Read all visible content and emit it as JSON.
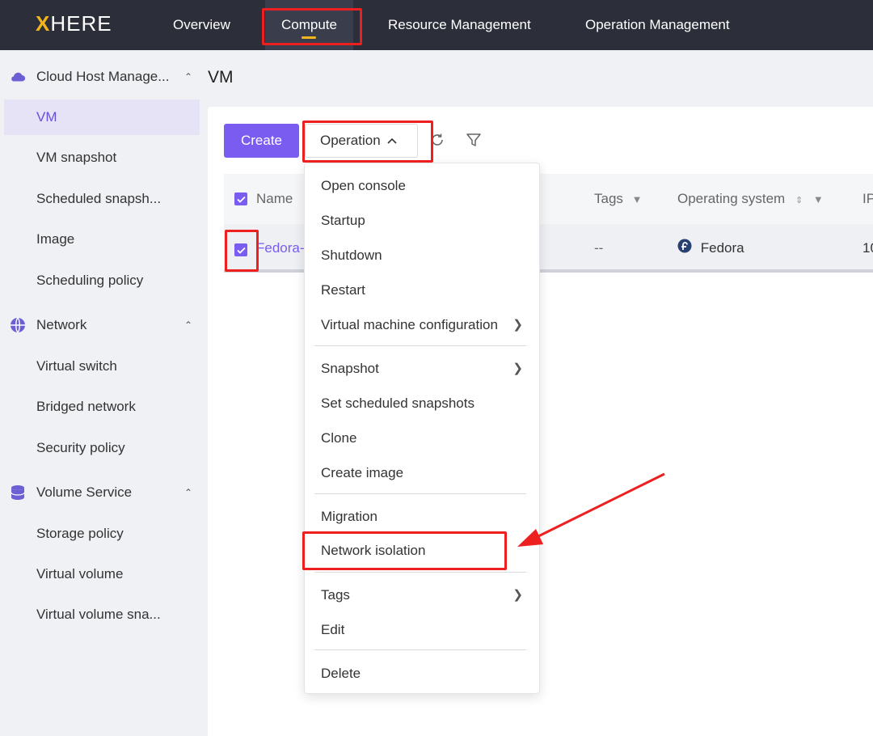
{
  "brand": {
    "x": "X",
    "rest": "HERE"
  },
  "nav": [
    "Overview",
    "Compute",
    "Resource Management",
    "Operation Management"
  ],
  "sidebar": {
    "groups": [
      {
        "label": "Cloud Host Manage...",
        "icon": "cloud-icon",
        "items": [
          "VM",
          "VM snapshot",
          "Scheduled snapsh...",
          "Image",
          "Scheduling policy"
        ]
      },
      {
        "label": "Network",
        "icon": "globe-icon",
        "items": [
          "Virtual switch",
          "Bridged network",
          "Security policy"
        ]
      },
      {
        "label": "Volume Service",
        "icon": "database-icon",
        "items": [
          "Storage policy",
          "Virtual volume",
          "Virtual volume sna..."
        ]
      }
    ],
    "active_item": "VM"
  },
  "page": {
    "title": "VM"
  },
  "toolbar": {
    "create_label": "Create",
    "operation_label": "Operation"
  },
  "table": {
    "headers": {
      "name": "Name",
      "tags": "Tags",
      "os": "Operating system",
      "ip": "IP"
    },
    "rows": [
      {
        "name": "Fedora-",
        "tags": "--",
        "os": "Fedora",
        "ip": "10"
      }
    ]
  },
  "operation_menu": [
    {
      "label": "Open console"
    },
    {
      "label": "Startup"
    },
    {
      "label": "Shutdown"
    },
    {
      "label": "Restart"
    },
    {
      "label": "Virtual machine configuration",
      "submenu": true
    },
    {
      "label": "Snapshot",
      "submenu": true
    },
    {
      "label": "Set scheduled snapshots"
    },
    {
      "label": "Clone"
    },
    {
      "label": "Create image"
    },
    {
      "label": "Migration"
    },
    {
      "label": "Network isolation",
      "highlighted": true
    },
    {
      "label": "Tags",
      "submenu": true
    },
    {
      "label": "Edit"
    },
    {
      "label": "Delete"
    }
  ],
  "colors": {
    "accent": "#7a5cf0",
    "topbar": "#2c2f3a",
    "brand_yellow": "#f2b51c",
    "annotation_red": "#ee1f1f"
  }
}
